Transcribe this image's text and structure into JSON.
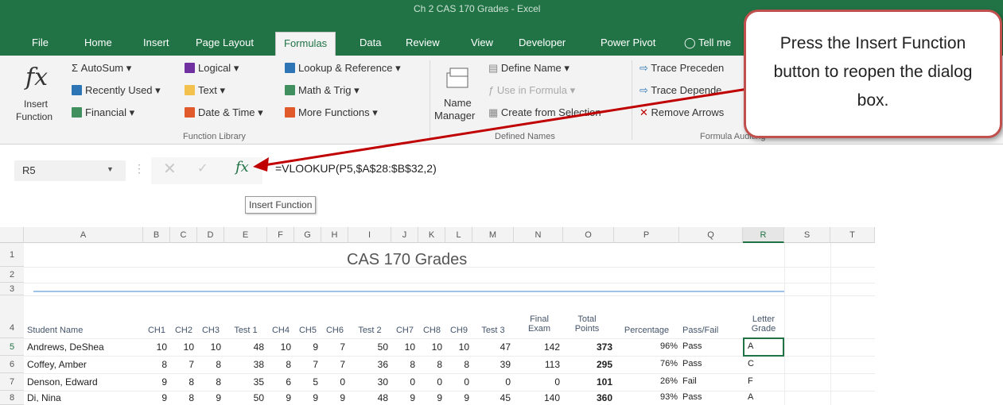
{
  "window": {
    "title": "Ch 2 CAS 170 Grades - Excel"
  },
  "tabs": [
    "File",
    "Home",
    "Insert",
    "Page Layout",
    "Formulas",
    "Data",
    "Review",
    "View",
    "Developer",
    "Power Pivot",
    "Tell me"
  ],
  "ribbon": {
    "function_library": {
      "insert_function": "Insert Function",
      "autosum": "AutoSum",
      "recently_used": "Recently Used",
      "financial": "Financial",
      "logical": "Logical",
      "text": "Text",
      "date_time": "Date & Time",
      "lookup": "Lookup & Reference",
      "math": "Math & Trig",
      "more": "More Functions",
      "label": "Function Library"
    },
    "defined_names": {
      "name_manager_1": "Name",
      "name_manager_2": "Manager",
      "define_name": "Define Name",
      "use_in_formula": "Use in Formula",
      "create_from_selection": "Create from Selection",
      "label": "Defined Names"
    },
    "formula_auditing": {
      "trace_precedents": "Trace Preceden",
      "trace_dependents": "Trace Depende",
      "remove_arrows": "Remove Arrows",
      "label": "Formula Auditing"
    }
  },
  "formula_bar": {
    "name_box": "R5",
    "fx": "fx",
    "formula": "=VLOOKUP(P5,$A$28:$B$32,2)",
    "tooltip": "Insert Function"
  },
  "callout": {
    "text": "Press the Insert Function button to reopen the dialog box."
  },
  "sheet": {
    "columns": [
      "A",
      "B",
      "C",
      "D",
      "E",
      "F",
      "G",
      "H",
      "I",
      "J",
      "K",
      "L",
      "M",
      "N",
      "O",
      "P",
      "Q",
      "R",
      "S",
      "T"
    ],
    "rows": [
      "1",
      "2",
      "3",
      "4",
      "5",
      "6",
      "7",
      "8"
    ],
    "title": "CAS 170 Grades",
    "headers": [
      "Student Name",
      "CH1",
      "CH2",
      "CH3",
      "Test 1",
      "CH4",
      "CH5",
      "CH6",
      "Test 2",
      "CH7",
      "CH8",
      "CH9",
      "Test 3",
      "Final Exam",
      "Total Points",
      "Percentage",
      "Pass/Fail",
      "Letter Grade"
    ],
    "data": [
      [
        "Andrews, DeShea",
        "10",
        "10",
        "10",
        "48",
        "10",
        "9",
        "7",
        "50",
        "10",
        "10",
        "10",
        "47",
        "142",
        "373",
        "96%",
        "Pass",
        "A"
      ],
      [
        "Coffey, Amber",
        "8",
        "7",
        "8",
        "38",
        "8",
        "7",
        "7",
        "36",
        "8",
        "8",
        "8",
        "39",
        "113",
        "295",
        "76%",
        "Pass",
        "C"
      ],
      [
        "Denson, Edward",
        "9",
        "8",
        "8",
        "35",
        "6",
        "5",
        "0",
        "30",
        "0",
        "0",
        "0",
        "0",
        "0",
        "101",
        "26%",
        "Fail",
        "F"
      ],
      [
        "Di, Nina",
        "9",
        "8",
        "9",
        "50",
        "9",
        "9",
        "9",
        "48",
        "9",
        "9",
        "9",
        "45",
        "140",
        "360",
        "93%",
        "Pass",
        "A"
      ]
    ]
  },
  "colors": {
    "excel_green": "#217346",
    "callout_border": "#c0504d",
    "arrow": "#c00000"
  }
}
